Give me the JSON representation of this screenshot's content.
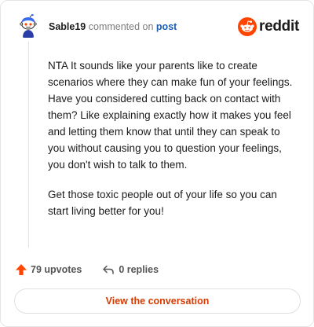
{
  "header": {
    "avatar": "snoo-avatar-icon",
    "username": "Sable19",
    "action_text": "commented on",
    "target_link": "post",
    "brand": "reddit"
  },
  "comment": {
    "paragraphs": [
      "NTA It sounds like your parents like to create scenarios where they can make fun of your feelings. Have you considered cutting back on contact with them? Like explaining exactly how it makes you feel and letting them know that until they can speak to you without causing you to question your feelings, you don't wish to talk to them.",
      "Get those toxic people out of your life so you can start living better for you!"
    ]
  },
  "footer": {
    "upvotes_label": "79 upvotes",
    "replies_label": "0 replies",
    "upvote_icon": "upvote-arrow-icon",
    "reply_icon": "reply-arrow-icon"
  },
  "cta": {
    "label": "View the conversation"
  },
  "colors": {
    "brand_orange": "#ff4500",
    "link_blue": "#1a5fb4",
    "cta_text": "#d93a00",
    "muted_text": "#7c7c7c"
  }
}
